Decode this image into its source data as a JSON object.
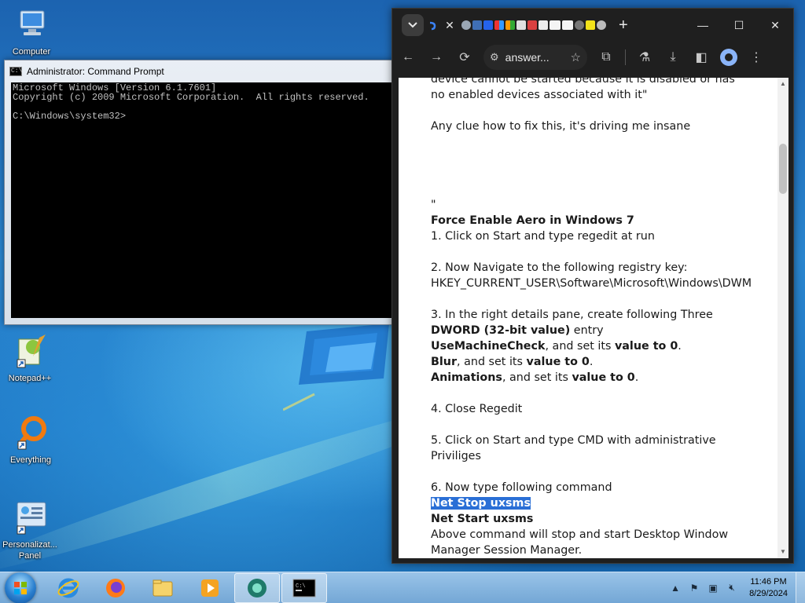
{
  "desktop": {
    "icons": [
      {
        "label": "Computer",
        "icon": "computer-icon"
      },
      {
        "label": "Notepad++",
        "icon": "notepadpp-icon"
      },
      {
        "label": "Everything",
        "icon": "everything-search-icon"
      },
      {
        "label": "Personalizat... Panel",
        "icon": "personalization-panel-icon"
      }
    ]
  },
  "cmd": {
    "title": "Administrator: Command Prompt",
    "lines": [
      "Microsoft Windows [Version 6.1.7601]",
      "Copyright (c) 2009 Microsoft Corporation.  All rights reserved.",
      "",
      "C:\\Windows\\system32>"
    ]
  },
  "browser": {
    "tab_close": "✕",
    "new_tab": "+",
    "address_text": "answer...",
    "window_controls": {
      "minimize": "—",
      "maximize": "☐",
      "close": "✕"
    },
    "content": {
      "p1": "device cannot be started because it is disabled or has no enabled devices associated with it\"",
      "p2": "Any clue how to fix this, it's driving me insane",
      "quote_mark": "\"",
      "heading": "Force Enable Aero in Windows 7",
      "step1": "1. Click on Start and type regedit at run",
      "step2a": "2. Now Navigate to the following registry key:",
      "step2b": "HKEY_CURRENT_USER\\Software\\Microsoft\\Windows\\DWM",
      "step3a": "3. In the right details pane, create following Three ",
      "step3b": "DWORD (32-bit value)",
      "step3c": " entry",
      "entry1_name": "UseMachineCheck",
      "entry2_name": "Blur",
      "entry3_name": "Animations",
      "entry_mid": ", and set its ",
      "entry_value": "value to 0",
      "entry_end": ".",
      "step4": "4. Close Regedit",
      "step5": "5. Click on Start and type CMD with administrative Priviliges",
      "step6": "6. Now type following command",
      "cmd1": "Net Stop uxsms",
      "cmd2": "Net Start uxsms",
      "closing": "Above command will stop and start Desktop Window Manager Session Manager."
    }
  },
  "taskbar": {
    "apps": [
      "internet-explorer-icon",
      "firefox-icon",
      "file-explorer-icon",
      "media-player-icon",
      "browser-app-icon",
      "command-prompt-icon"
    ],
    "clock_time": "11:46 PM",
    "clock_date": "8/29/2024"
  }
}
